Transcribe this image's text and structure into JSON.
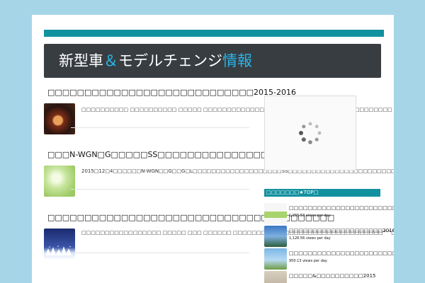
{
  "site": {
    "logo_main": "新型車",
    "logo_amp": "＆",
    "logo_mid": "モデルチェンジ",
    "logo_info": "情報"
  },
  "posts": [
    {
      "title": "□□□□□□□□□□□□□□□□□□□□□□□□□□□□2015-2016",
      "excerpt": "□□□□□□□□□□ □□□□□□□□□□ □□□□□ □□□□□□□□□□□□□□□□□□□□ □□□□□□□□□□□□□□□□□□□□ □□□□□□□□□□□□□□□□□□□□□□□□□□□□□□□□□□□ □□□ [...]"
    },
    {
      "title": "□□□N-WGN□G□□□□□SS□□□□□□□□□□□□□□□□□",
      "excerpt": "2015□12□4□□□□□□N-WGN□□G□□G□L□□□□□□□□□□□□□□□□□□□SS□□□□□□□□□□□□□□□□□□□□□□□□□□ □□□□□□ □□□□ □ □□□□□□□□□□□□□□□□ [..."
    },
    {
      "title": "□□□□□□□□□□□□□□□□□□□□□□□□□□□□□□□□□□□□□□□",
      "excerpt": "□□□□□□□□□□□□□□□□□ □□□□□ □□□ □□□□□□ □□□□□□□□□□□□□□□□□□□□□□□□□□□□□□□□^^□ □□□□□□□□□□□□"
    }
  ],
  "sidebar": {
    "widget_title": "□□□□□□□★TOP□",
    "items": [
      {
        "title": "□□□□□□□□□□□□□□□□□□□□□□□□□□□□□□□□□□□□□□",
        "views": "1,255.53 views per day"
      },
      {
        "title": "□□□□□□□□□□□□□□□□□□□□2016□□□□□□□□□□[...",
        "views": "1,126.56 views per day"
      },
      {
        "title": "□□□□□□□□□□□□□□□□□□□□□□□JC08□□□27.2k",
        "views": "950.13 views per day"
      },
      {
        "title": "□□□□□&□□□□□□□□□□2015",
        "views": ""
      }
    ]
  }
}
